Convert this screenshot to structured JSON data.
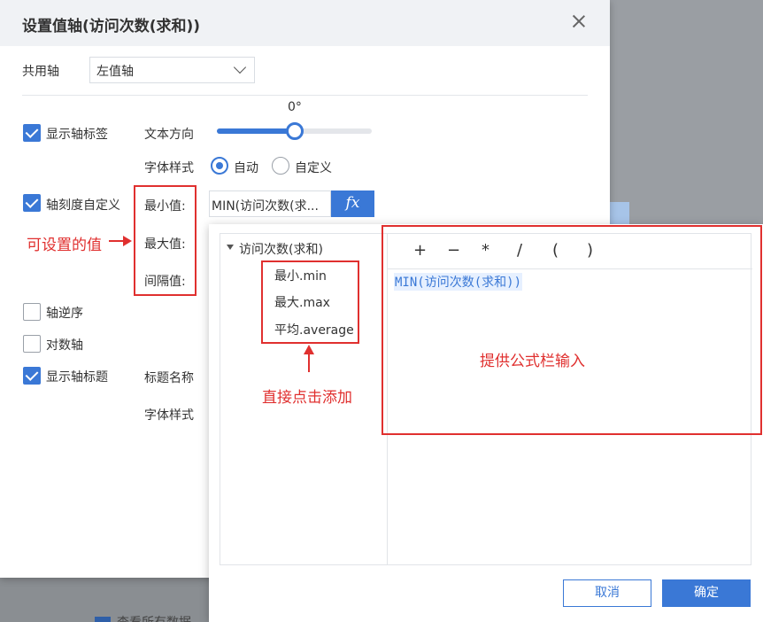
{
  "dialog": {
    "title": "设置值轴(访问次数(求和))",
    "shared_axis_label": "共用轴",
    "shared_axis_value": "左值轴",
    "show_axis_label": {
      "label": "显示轴标签",
      "checked": true
    },
    "text_direction": {
      "label": "文本方向",
      "angle": "0°",
      "slider_fraction": 0.5
    },
    "font_style": {
      "label": "字体样式",
      "options": [
        "自动",
        "自定义"
      ],
      "selected": "自动"
    },
    "custom_scale": {
      "label": "轴刻度自定义",
      "checked": true
    },
    "min_label": "最小值:",
    "max_label": "最大值:",
    "interval_label": "间隔值:",
    "min_value": "MIN(访问次数(求...",
    "fx_label": "fx",
    "reverse_axis": {
      "label": "轴逆序",
      "checked": false
    },
    "log_axis": {
      "label": "对数轴",
      "checked": false
    },
    "show_axis_title": {
      "label": "显示轴标题",
      "checked": true
    },
    "title_name_label": "标题名称",
    "title_font_style_label": "字体样式"
  },
  "formula_editor": {
    "tree_root": "访问次数(求和)",
    "functions": [
      "最小.min",
      "最大.max",
      "平均.average"
    ],
    "operators": [
      "+",
      "−",
      "*",
      "/",
      "(",
      ")"
    ],
    "formula": "MIN(访问次数(求和))",
    "cancel_label": "取消",
    "ok_label": "确定"
  },
  "annotations": {
    "settable_values": "可设置的值",
    "click_to_add": "直接点击添加",
    "formula_input": "提供公式栏输入"
  },
  "background": {
    "bottom_text": "查看所有数据"
  },
  "colors": {
    "accent": "#3a78d6",
    "annotation": "#e0302f"
  }
}
